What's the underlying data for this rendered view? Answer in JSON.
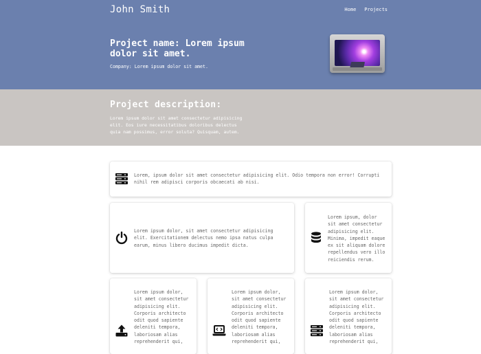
{
  "header": {
    "brand": "John Smith",
    "nav": [
      {
        "label": "Home"
      },
      {
        "label": "Projects"
      }
    ],
    "project_title": "Project name: Lorem ipsum dolor sit amet.",
    "company": "Company: Lorem ipsum dolor sit amet."
  },
  "description": {
    "title": "Project description:",
    "text": "Lorem ipsum dolor sit amet consectetur adipisicing elit. Eos iure necessitatibus doloribus delectus quia nam possimus, error soluta? Quisquam, autem."
  },
  "cards": [
    {
      "icon": "server-icon",
      "text": "Lorem, ipsum dolor sit amet consectetur adipisicing elit. Odio tempora non error! Corrupti nihil rem adipisci corporis obcaecati ab nisi."
    },
    {
      "icon": "power-icon",
      "text": "Lorem ipsum dolor, sit amet consectetur adipisicing elit. Exercitationem delectus nemo ipsa natus culpa earum, minus libero ducimus impedit dicta."
    },
    {
      "icon": "database-icon",
      "text": "Lorem ipsum, dolor sit amet consectetur adipisicing elit. Minima, impedit eaque ex sit aliquam dolore repellendus vero illo reiciendis rerum."
    },
    {
      "icon": "upload-icon",
      "text": "Lorem ipsum dolor, sit amet consectetur adipisicing elit. Corporis architecto odit quod sapiente deleniti tempora, laboriosam alias reprehenderit qui,"
    },
    {
      "icon": "laptop-code-icon",
      "text": "Lorem ipsum dolor, sit amet consectetur adipisicing elit. Corporis architecto odit quod sapiente deleniti tempora, laboriosam alias reprehenderit qui,"
    },
    {
      "icon": "server-icon",
      "text": "Lorem ipsum dolor, sit amet consectetur adipisicing elit. Corporis architecto odit quod sapiente deleniti tempora, laboriosam alias reprehenderit qui,"
    }
  ],
  "colors": {
    "hero_bg": "#6b80ae",
    "description_bg": "#c9c5c2",
    "card_bg": "#ffffff",
    "icon": "#111111"
  }
}
